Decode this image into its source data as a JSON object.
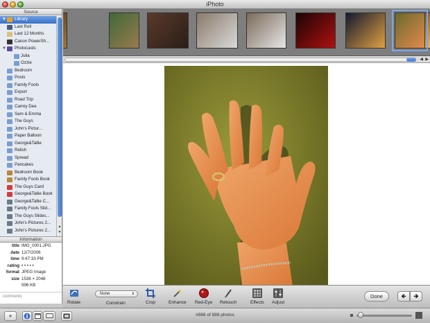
{
  "window": {
    "title": "iPhoto"
  },
  "source": {
    "header": "Source",
    "items": [
      {
        "label": "Library",
        "icon": "library-icon",
        "kind": "library",
        "selected": true,
        "expanded": true
      },
      {
        "label": "Last Roll",
        "icon": "film-roll-icon",
        "kind": "roll"
      },
      {
        "label": "Last 12 Months",
        "icon": "calendar-icon",
        "kind": "months"
      },
      {
        "label": "Canon PowerSh...",
        "icon": "camera-icon",
        "kind": "camera"
      },
      {
        "label": "Photocasts",
        "icon": "photocast-icon",
        "kind": "photocasts",
        "expanded": true
      },
      {
        "label": "Julia",
        "icon": "album-icon",
        "kind": "album",
        "indent": true
      },
      {
        "label": "Ozzie",
        "icon": "album-icon",
        "kind": "album",
        "indent": true
      },
      {
        "label": "Bedroom",
        "icon": "album-icon",
        "kind": "album"
      },
      {
        "label": "Posts",
        "icon": "album-icon",
        "kind": "album"
      },
      {
        "label": "Family Fools",
        "icon": "album-icon",
        "kind": "album"
      },
      {
        "label": "Export",
        "icon": "album-icon",
        "kind": "album"
      },
      {
        "label": "Road Trip",
        "icon": "album-icon",
        "kind": "album"
      },
      {
        "label": "Carrey Dee",
        "icon": "album-icon",
        "kind": "album"
      },
      {
        "label": "Sam & Emma",
        "icon": "album-icon",
        "kind": "album"
      },
      {
        "label": "The Guys",
        "icon": "album-icon",
        "kind": "album"
      },
      {
        "label": "John's Pictur...",
        "icon": "album-icon",
        "kind": "album"
      },
      {
        "label": "Paper Balloon",
        "icon": "album-icon",
        "kind": "album"
      },
      {
        "label": "George&Tallie",
        "icon": "album-icon",
        "kind": "album"
      },
      {
        "label": "Relish",
        "icon": "album-icon",
        "kind": "album"
      },
      {
        "label": "Spread",
        "icon": "album-icon",
        "kind": "album"
      },
      {
        "label": "Pancakes",
        "icon": "album-icon",
        "kind": "album"
      },
      {
        "label": "Bedroom Book",
        "icon": "book-icon",
        "kind": "book"
      },
      {
        "label": "Family Fools Book",
        "icon": "book-icon",
        "kind": "book"
      },
      {
        "label": "The Guys Card",
        "icon": "card-icon",
        "kind": "card"
      },
      {
        "label": "George&Tallie Book",
        "icon": "card-icon",
        "kind": "card"
      },
      {
        "label": "George&Tallie C...",
        "icon": "slideshow-icon",
        "kind": "slides"
      },
      {
        "label": "Family Fools Slid...",
        "icon": "slideshow-icon",
        "kind": "slides"
      },
      {
        "label": "The Guys Slides...",
        "icon": "slideshow-icon",
        "kind": "slides"
      },
      {
        "label": "John's Pictures 2...",
        "icon": "slideshow-icon",
        "kind": "slides"
      },
      {
        "label": "John's Pictures 2...",
        "icon": "slideshow-icon",
        "kind": "slides"
      }
    ]
  },
  "information": {
    "header": "Information",
    "rows": [
      {
        "key": "title",
        "value": "IMG_0001.JPG"
      },
      {
        "key": "date",
        "value": "12/7/2006"
      },
      {
        "key": "time",
        "value": "9:47:33 PM"
      },
      {
        "key": "rating",
        "value": "• • • • •"
      },
      {
        "key": "format",
        "value": "JPEG Image"
      },
      {
        "key": "size",
        "value": "1536 × 2048"
      },
      {
        "key": "",
        "value": "996 KB"
      }
    ],
    "comments_placeholder": "comments"
  },
  "filmstrip": {
    "thumbnails": [
      {
        "name": "thumb-edge",
        "colors": [
          "#5d4a2a",
          "#a2763a"
        ]
      },
      {
        "name": "thumb-tree",
        "colors": [
          "#3f6a3a",
          "#9a7a4c"
        ]
      },
      {
        "name": "thumb-room",
        "colors": [
          "#5a3a2a",
          "#2a1e18"
        ]
      },
      {
        "name": "thumb-pipe-1",
        "colors": [
          "#8a7a6a",
          "#d9d9d9"
        ]
      },
      {
        "name": "thumb-pipe-2",
        "colors": [
          "#7a6a5a",
          "#e6e6e6"
        ]
      },
      {
        "name": "thumb-red-light",
        "colors": [
          "#1a0505",
          "#b01010"
        ]
      },
      {
        "name": "thumb-box",
        "colors": [
          "#121a30",
          "#e0a040"
        ]
      },
      {
        "name": "thumb-bulb",
        "colors": [
          "#402010",
          "#f0c060"
        ]
      },
      {
        "name": "thumb-hand",
        "colors": [
          "#6a6a30",
          "#e28a4a"
        ],
        "selected": true
      }
    ]
  },
  "edit_tools": {
    "rotate": "Rotate",
    "constrain_value": "None",
    "constrain": "Constrain",
    "crop": "Crop",
    "enhance": "Enhance",
    "red_eye": "Red-Eye",
    "retouch": "Retouch",
    "effects": "Effects",
    "adjust": "Adjust",
    "done": "Done",
    "prev_arrow": "🡸",
    "next_arrow": "🡺"
  },
  "bottom_bar": {
    "add_symbol": "+",
    "photo_count": "#888 of 888 photos"
  },
  "colors": {
    "selection_blue": "#3a70c8",
    "window_gray": "#c8c8c8"
  }
}
